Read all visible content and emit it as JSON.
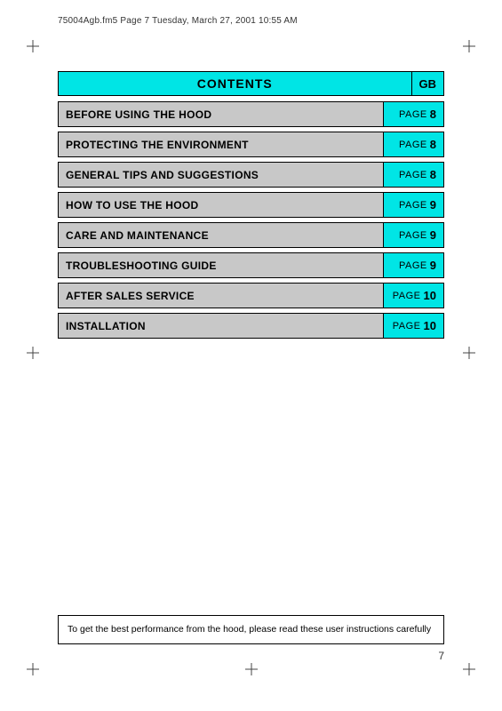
{
  "header": {
    "file_info": "75004Agb.fm5  Page 7  Tuesday, March 27, 2001  10:55 AM"
  },
  "contents": {
    "title": "CONTENTS",
    "gb_label": "GB",
    "rows": [
      {
        "label": "BEFORE USING THE HOOD",
        "page_word": "PAGE",
        "page_num": "8"
      },
      {
        "label": "PROTECTING THE ENVIRONMENT",
        "page_word": "PAGE",
        "page_num": "8"
      },
      {
        "label": "GENERAL TIPS AND SUGGESTIONS",
        "page_word": "PAGE",
        "page_num": "8"
      },
      {
        "label": "HOW TO USE THE HOOD",
        "page_word": "PAGE",
        "page_num": "9"
      },
      {
        "label": "CARE AND MAINTENANCE",
        "page_word": "PAGE",
        "page_num": "9"
      },
      {
        "label": "TROUBLESHOOTING GUIDE",
        "page_word": "PAGE",
        "page_num": "9"
      },
      {
        "label": "AFTER SALES SERVICE",
        "page_word": "PAGE",
        "page_num": "10"
      },
      {
        "label": "INSTALLATION",
        "page_word": "PAGE",
        "page_num": "10"
      }
    ]
  },
  "bottom_note": "To get the best performance from the hood, please read these user instructions carefully",
  "page_number": "7"
}
